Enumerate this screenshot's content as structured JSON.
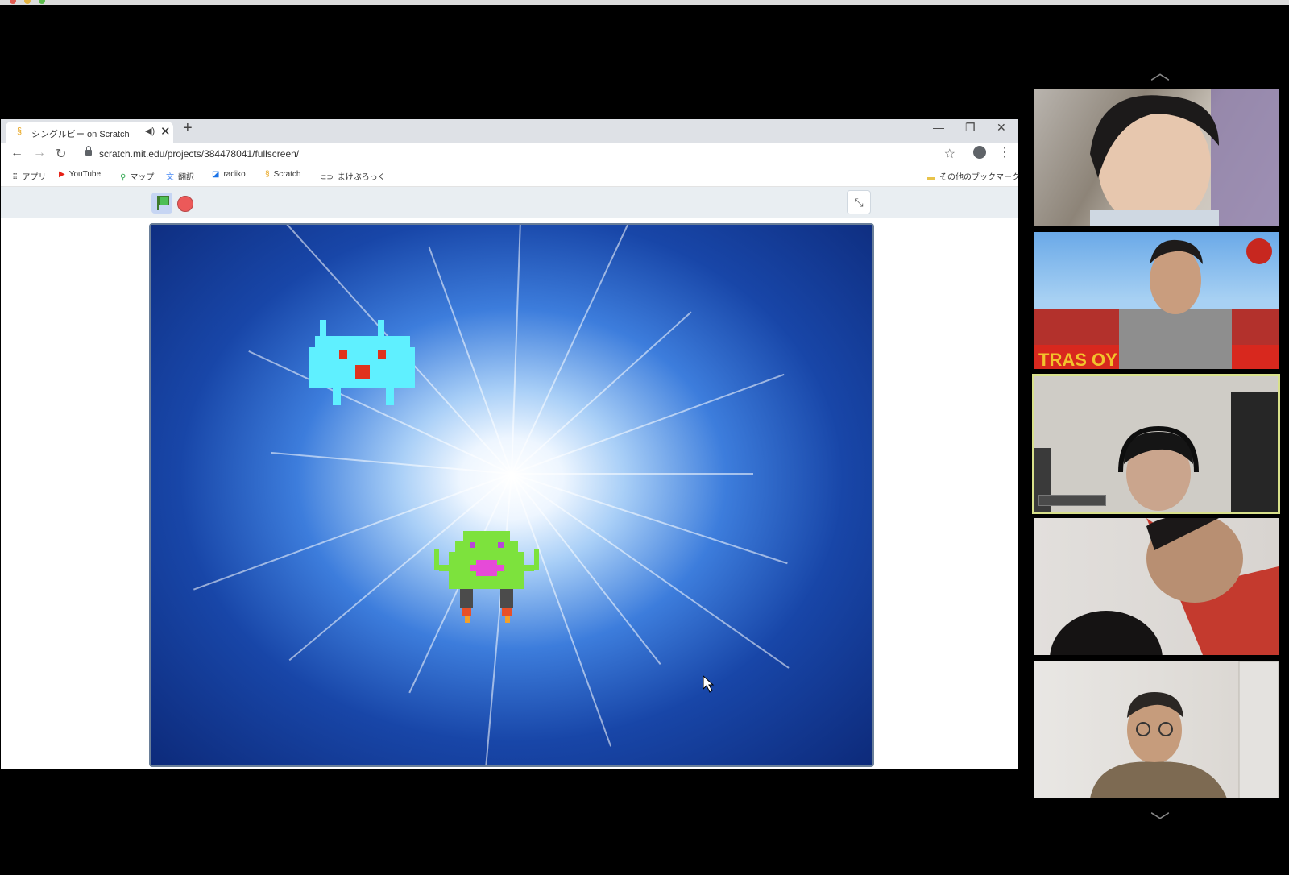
{
  "browser": {
    "tab_title": "シングルビー on Scratch",
    "url": "scratch.mit.edu/projects/384478041/fullscreen/",
    "bookmarks": [
      {
        "label": "アプリ",
        "icon": "apps-grid-icon"
      },
      {
        "label": "YouTube",
        "icon": "youtube-icon"
      },
      {
        "label": "マップ",
        "icon": "maps-pin-icon"
      },
      {
        "label": "翻訳",
        "icon": "translate-icon"
      },
      {
        "label": "radiko",
        "icon": "radiko-icon"
      },
      {
        "label": "Scratch",
        "icon": "scratch-icon"
      },
      {
        "label": "まけぶろっく",
        "icon": "link-icon"
      }
    ],
    "other_bookmarks": "その他のブックマーク"
  },
  "scratch": {
    "controls": [
      "green-flag",
      "stop"
    ]
  },
  "video_panel": {
    "participants": [
      {
        "id": "p1",
        "active": false
      },
      {
        "id": "p2",
        "active": false,
        "banner_text": "TRAS   OY"
      },
      {
        "id": "p3",
        "active": true
      },
      {
        "id": "p4",
        "active": false
      },
      {
        "id": "p5",
        "active": false
      }
    ]
  },
  "colors": {
    "accent_active": "#d8e08a",
    "stop": "#ec5959",
    "flag": "#4cbf56"
  }
}
